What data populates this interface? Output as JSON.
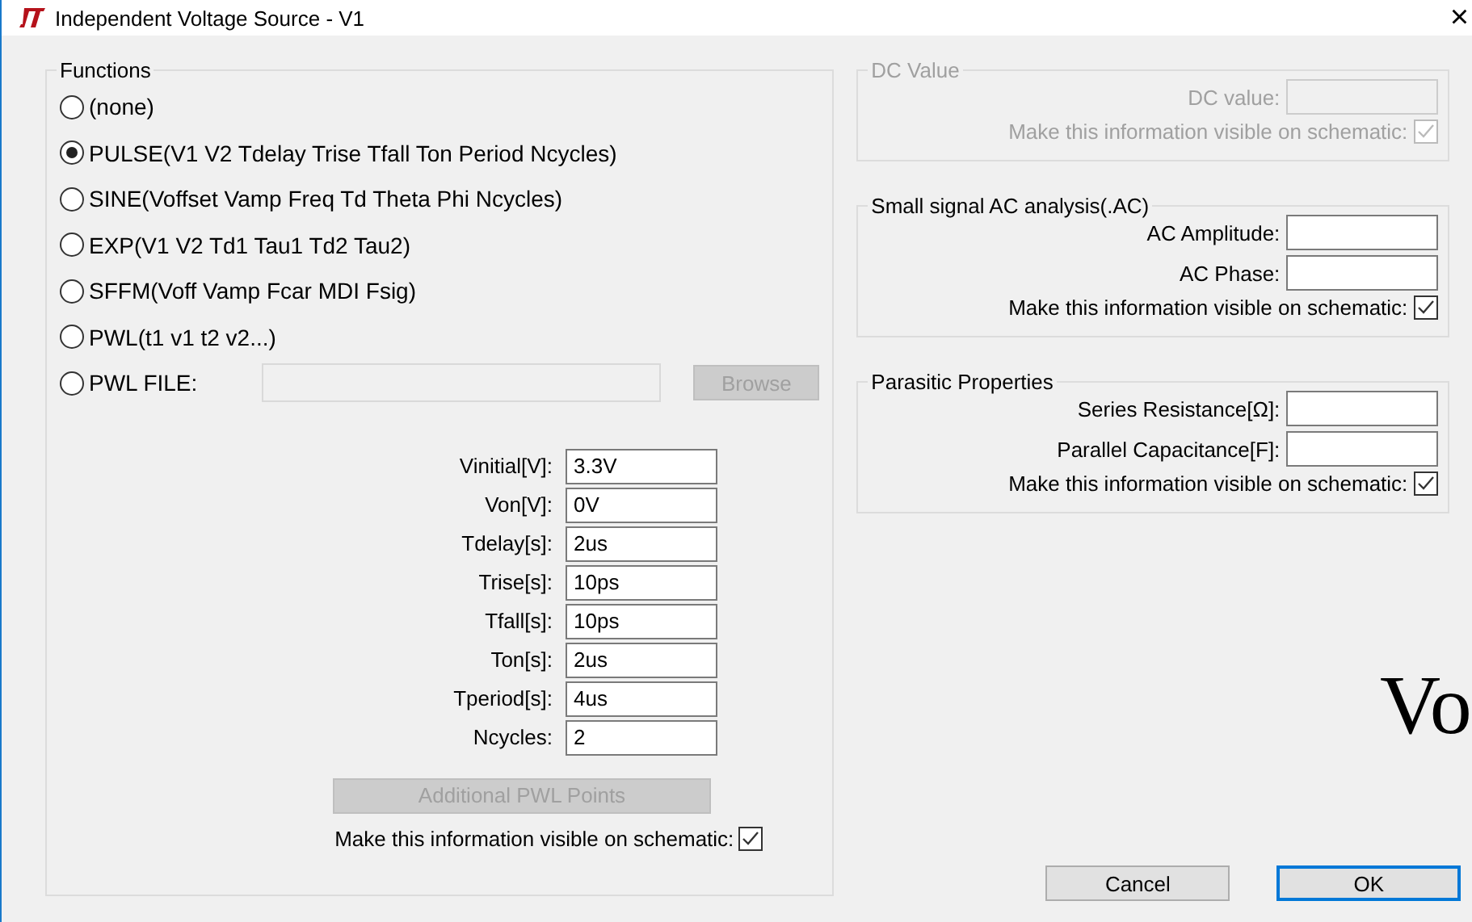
{
  "window": {
    "title": "Independent Voltage Source - V1",
    "close": "×"
  },
  "functions": {
    "title": "Functions",
    "options": [
      {
        "label": "(none)",
        "selected": false
      },
      {
        "label": "PULSE(V1 V2 Tdelay Trise Tfall Ton Period Ncycles)",
        "selected": true
      },
      {
        "label": "SINE(Voffset Vamp Freq Td Theta Phi Ncycles)",
        "selected": false
      },
      {
        "label": "EXP(V1 V2 Td1 Tau1 Td2 Tau2)",
        "selected": false
      },
      {
        "label": "SFFM(Voff Vamp Fcar MDI Fsig)",
        "selected": false
      },
      {
        "label": "PWL(t1 v1 t2 v2...)",
        "selected": false
      },
      {
        "label": "PWL FILE:",
        "selected": false,
        "kind": "file"
      }
    ],
    "browse": {
      "label": "Browse",
      "disabled": true
    },
    "parameters": [
      {
        "label": "Vinitial[V]:",
        "value": "3.3V"
      },
      {
        "label": "Von[V]:",
        "value": "0V"
      },
      {
        "label": "Tdelay[s]:",
        "value": "2us"
      },
      {
        "label": "Trise[s]:",
        "value": "10ps"
      },
      {
        "label": "Tfall[s]:",
        "value": "10ps"
      },
      {
        "label": "Ton[s]:",
        "value": "2us"
      },
      {
        "label": "Tperiod[s]:",
        "value": "4us"
      },
      {
        "label": "Ncycles:",
        "value": "2"
      }
    ],
    "pwl_button": {
      "label": "Additional PWL Points",
      "disabled": true
    },
    "visible": {
      "label": "Make this information visible on schematic:",
      "checked": true
    }
  },
  "groups": [
    {
      "title": "DC Value",
      "disabled": true,
      "fields": [
        {
          "label": "DC value:"
        }
      ],
      "visible": {
        "label": "Make this information visible on schematic:",
        "checked": true
      }
    },
    {
      "title": "Small signal AC analysis(.AC)",
      "disabled": false,
      "fields": [
        {
          "label": "AC Amplitude:"
        },
        {
          "label": "AC Phase:"
        }
      ],
      "visible": {
        "label": "Make this information visible on schematic:",
        "checked": true
      }
    },
    {
      "title": "Parasitic Properties",
      "disabled": false,
      "fields": [
        {
          "label": "Series Resistance[Ω]:"
        },
        {
          "label": "Parallel Capacitance[F]:"
        }
      ],
      "visible": {
        "label": "Make this information visible on schematic:",
        "checked": true
      }
    }
  ],
  "overlay_text": "Vo",
  "buttons": [
    {
      "label": "Cancel",
      "default": false
    },
    {
      "label": "OK",
      "default": true
    }
  ]
}
